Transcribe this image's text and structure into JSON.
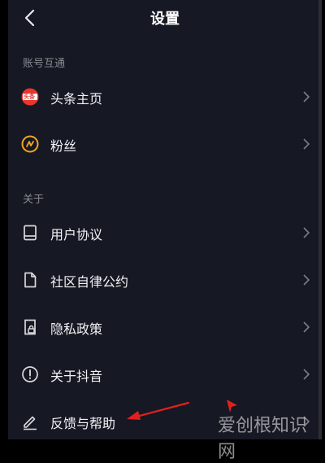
{
  "header": {
    "title": "设置"
  },
  "sections": [
    {
      "label": "账号互通",
      "items": [
        {
          "label": "头条主页",
          "icon": "toutiao-logo-icon",
          "badge_text": "头条"
        },
        {
          "label": "粉丝",
          "icon": "fans-icon"
        }
      ]
    },
    {
      "label": "关于",
      "items": [
        {
          "label": "用户协议",
          "icon": "book-icon"
        },
        {
          "label": "社区自律公约",
          "icon": "document-icon"
        },
        {
          "label": "隐私政策",
          "icon": "privacy-lock-icon"
        },
        {
          "label": "关于抖音",
          "icon": "info-icon"
        },
        {
          "label": "反馈与帮助",
          "icon": "edit-icon"
        }
      ]
    }
  ],
  "watermark": "爱创根知识网",
  "colors": {
    "background": "#161823",
    "toutiao_red": "#e8352e",
    "fans_orange": "#f5a623",
    "annotation_red": "#e02020"
  }
}
